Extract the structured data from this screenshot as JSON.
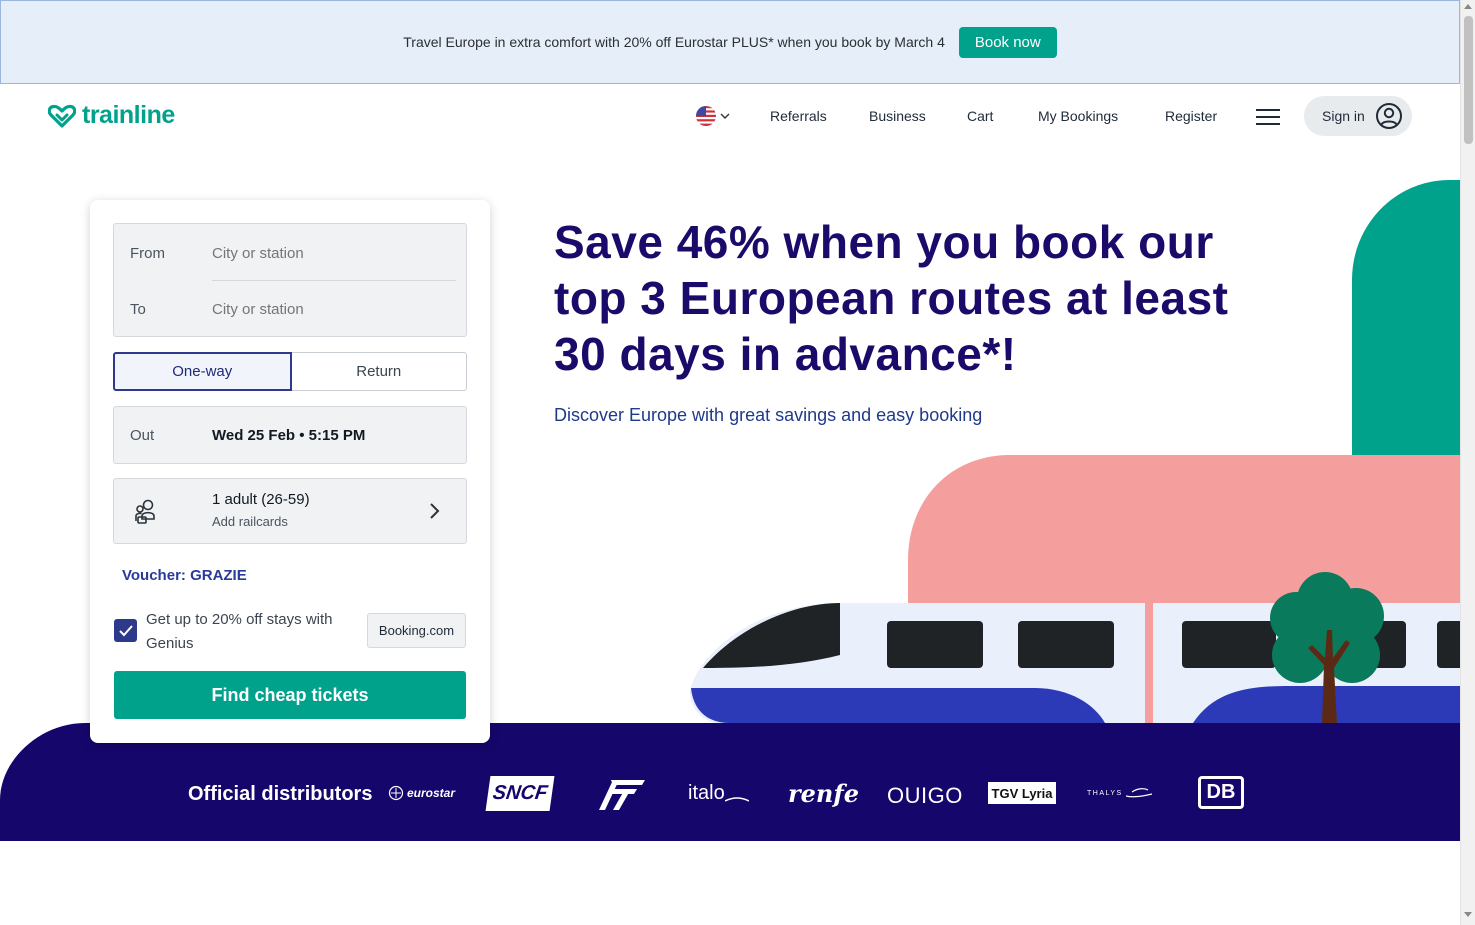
{
  "promo": {
    "text": "Travel Europe in extra comfort with 20% off Eurostar PLUS* when you book by March 4",
    "button": "Book now"
  },
  "header": {
    "logo": "trainline",
    "nav": [
      "Referrals",
      "Business",
      "Cart",
      "My Bookings",
      "Register"
    ],
    "signin": "Sign in"
  },
  "search": {
    "from_label": "From",
    "from_placeholder": "City or station",
    "to_label": "To",
    "to_placeholder": "City or station",
    "trip_types": [
      "One-way",
      "Return"
    ],
    "trip_selected": "One-way",
    "out_label": "Out",
    "out_value": "Wed 25 Feb • 5:15 PM",
    "passengers": "1 adult (26-59)",
    "railcards": "Add railcards",
    "voucher": "Voucher: GRAZIE",
    "genius_text": "Get up to 20% off stays with Genius",
    "genius_checked": true,
    "booking_badge": "Booking.com",
    "submit": "Find cheap tickets"
  },
  "hero": {
    "title": "Save 46% when you book our top 3 European routes at least 30 days in advance*!",
    "subtitle": "Discover Europe with great savings and easy booking"
  },
  "distributors": {
    "title": "Official distributors",
    "logos": [
      "eurostar",
      "SNCF",
      "Trenitalia",
      "italo",
      "renfe",
      "OUIGO",
      "TGV Lyria",
      "THALYS",
      "DB"
    ]
  },
  "colors": {
    "brand": "#00a28c",
    "navy": "#1c0a6a",
    "selected": "#2d3a8c",
    "banner_bg": "#e5eef9",
    "pink": "#f59e9e"
  },
  "icons": {
    "flag": "us-flag-icon",
    "menu": "hamburger-icon",
    "account": "user-circle-icon",
    "passengers": "passengers-icon",
    "chevron": "chevron-right-icon",
    "check": "check-icon"
  }
}
